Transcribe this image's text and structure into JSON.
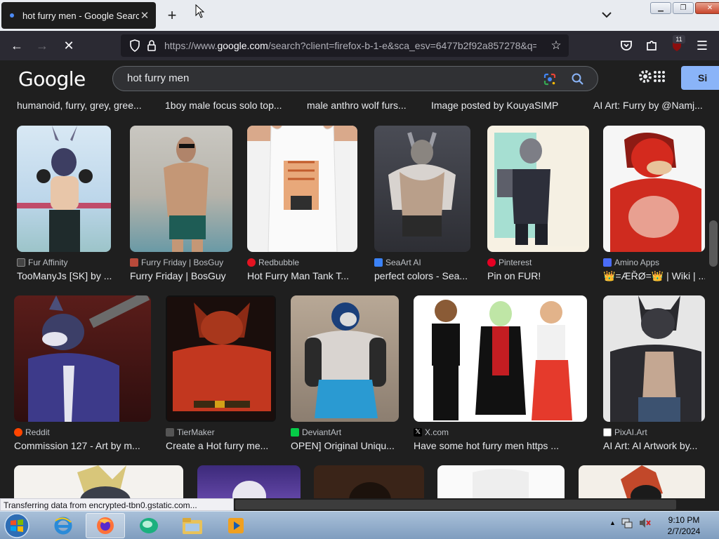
{
  "browser": {
    "tab_title": "hot furry men - Google Search",
    "url_prefix": "https://www.",
    "url_domain": "google.com",
    "url_rest": "/search?client=firefox-b-1-e&sca_esv=6477b2f92a857278&q=",
    "extension_badge": "11",
    "status_text": "Transferring data from encrypted-tbn0.gstatic.com..."
  },
  "google": {
    "logo": "Google",
    "query": "hot furry men",
    "signin_label": "Si"
  },
  "top_captions": [
    "humanoid, furry, grey, gree...",
    "1boy male focus solo top...",
    "male anthro wolf furs...",
    "Image posted by KouyaSIMP",
    "AI Art: Furry by @Namj..."
  ],
  "row1": [
    {
      "source": "Fur Affinity",
      "title": "TooManyJs [SK] by ...",
      "icon_color": "#ffffff"
    },
    {
      "source": "Furry Friday | BosGuy",
      "title": "Furry Friday | BosGuy",
      "icon_color": "#b84a3a"
    },
    {
      "source": "Redbubble",
      "title": "Hot Furry Man Tank T...",
      "icon_color": "#e41321"
    },
    {
      "source": "SeaArt AI",
      "title": "perfect colors - Sea...",
      "icon_color": "#3b82f6"
    },
    {
      "source": "Pinterest",
      "title": "Pin on FUR!",
      "icon_color": "#e60023"
    },
    {
      "source": "Amino Apps",
      "title": "👑=ÆŘØ=👑 | Wiki | ...",
      "icon_color": "#4a6cf7"
    }
  ],
  "row2": [
    {
      "source": "Reddit",
      "title": "Commission 127 - Art by m...",
      "icon_color": "#ff4500"
    },
    {
      "source": "TierMaker",
      "title": "Create a Hot furry me...",
      "icon_color": "#555555"
    },
    {
      "source": "DeviantArt",
      "title": "OPEN] Original Uniqu...",
      "icon_color": "#05cc47"
    },
    {
      "source": "X.com",
      "title": "Have some hot furry men https ...",
      "icon_color": "#000000"
    },
    {
      "source": "PixAI.Art",
      "title": "AI Art: AI Artwork by...",
      "icon_color": "#ffffff"
    }
  ],
  "clock": {
    "time": "9:10 PM",
    "date": "2/7/2024"
  }
}
